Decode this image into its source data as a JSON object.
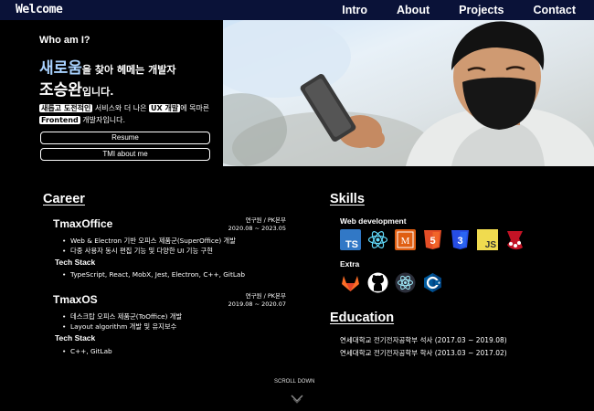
{
  "nav": {
    "logo": "Welcome",
    "links": [
      "Intro",
      "About",
      "Projects",
      "Contact"
    ]
  },
  "intro": {
    "who": "Who am I?",
    "line1_big": "새로움",
    "line1_rest": "을 찾아 헤메는 개발자",
    "line2_big": "조승완",
    "line2_rest": "입니다.",
    "desc_hl1": "새롭고 도전적인",
    "desc_mid1": " 서비스와 더 나은 ",
    "desc_hl2": "UX 개발",
    "desc_mid2": "에 목마른 ",
    "desc_hl3": "Frontend",
    "desc_end": " 개발자입니다.",
    "resume_label": "Resume",
    "tmi_label": "TMI about me"
  },
  "career": {
    "title": "Career",
    "jobs": [
      {
        "company": "TmaxOffice",
        "team": "연구원 / PK본부",
        "period": "2020.08 ~ 2023.05",
        "bullets": [
          "Web & Electron 기반 오피스 제품군(SuperOffice) 개발",
          "다중 사용자 동시 편집 기능 및 다양한 UI 기능 구현"
        ],
        "stack_title": "Tech Stack",
        "stack": "TypeScript, React, MobX, Jest, Electron, C++, GitLab"
      },
      {
        "company": "TmaxOS",
        "team": "연구원 / PK본부",
        "period": "2019.08 ~ 2020.07",
        "bullets": [
          "데스크탑 오피스 제품군(ToOffice) 개발",
          "Layout algorithm 개발 및 유지보수"
        ],
        "stack_title": "Tech Stack",
        "stack": "C++, GitLab"
      }
    ]
  },
  "skills": {
    "title": "Skills",
    "web_title": "Web development",
    "web_icons": [
      "typescript-icon",
      "react-icon",
      "mobx-icon",
      "html5-icon",
      "css3-icon",
      "javascript-icon",
      "jest-icon"
    ],
    "extra_title": "Extra",
    "extra_icons": [
      "gitlab-icon",
      "github-icon",
      "electron-icon",
      "cpp-icon"
    ],
    "ts_text": "TS",
    "js_text": "JS",
    "mobx_text": "M",
    "html_text": "5",
    "css_text": "3"
  },
  "education": {
    "title": "Education",
    "items": [
      "연세대학교 전기전자공학부 석사 (2017.03 ~ 2019.08)",
      "연세대학교 전기전자공학부 학사 (2013.03 ~ 2017.02)"
    ]
  },
  "footer": {
    "scroll": "SCROLL DOWN"
  },
  "colors": {
    "nav_bg": "#0a1238",
    "accent_blue": "#a9d2ff",
    "ts": "#3178c6",
    "react": "#61dafb",
    "mobx": "#e05e11",
    "html": "#e44d26",
    "css": "#264de4",
    "js": "#f0db4f",
    "jest": "#c21325",
    "gitlab": "#fc6d26",
    "electron": "#47848f",
    "cpp": "#00599c"
  }
}
